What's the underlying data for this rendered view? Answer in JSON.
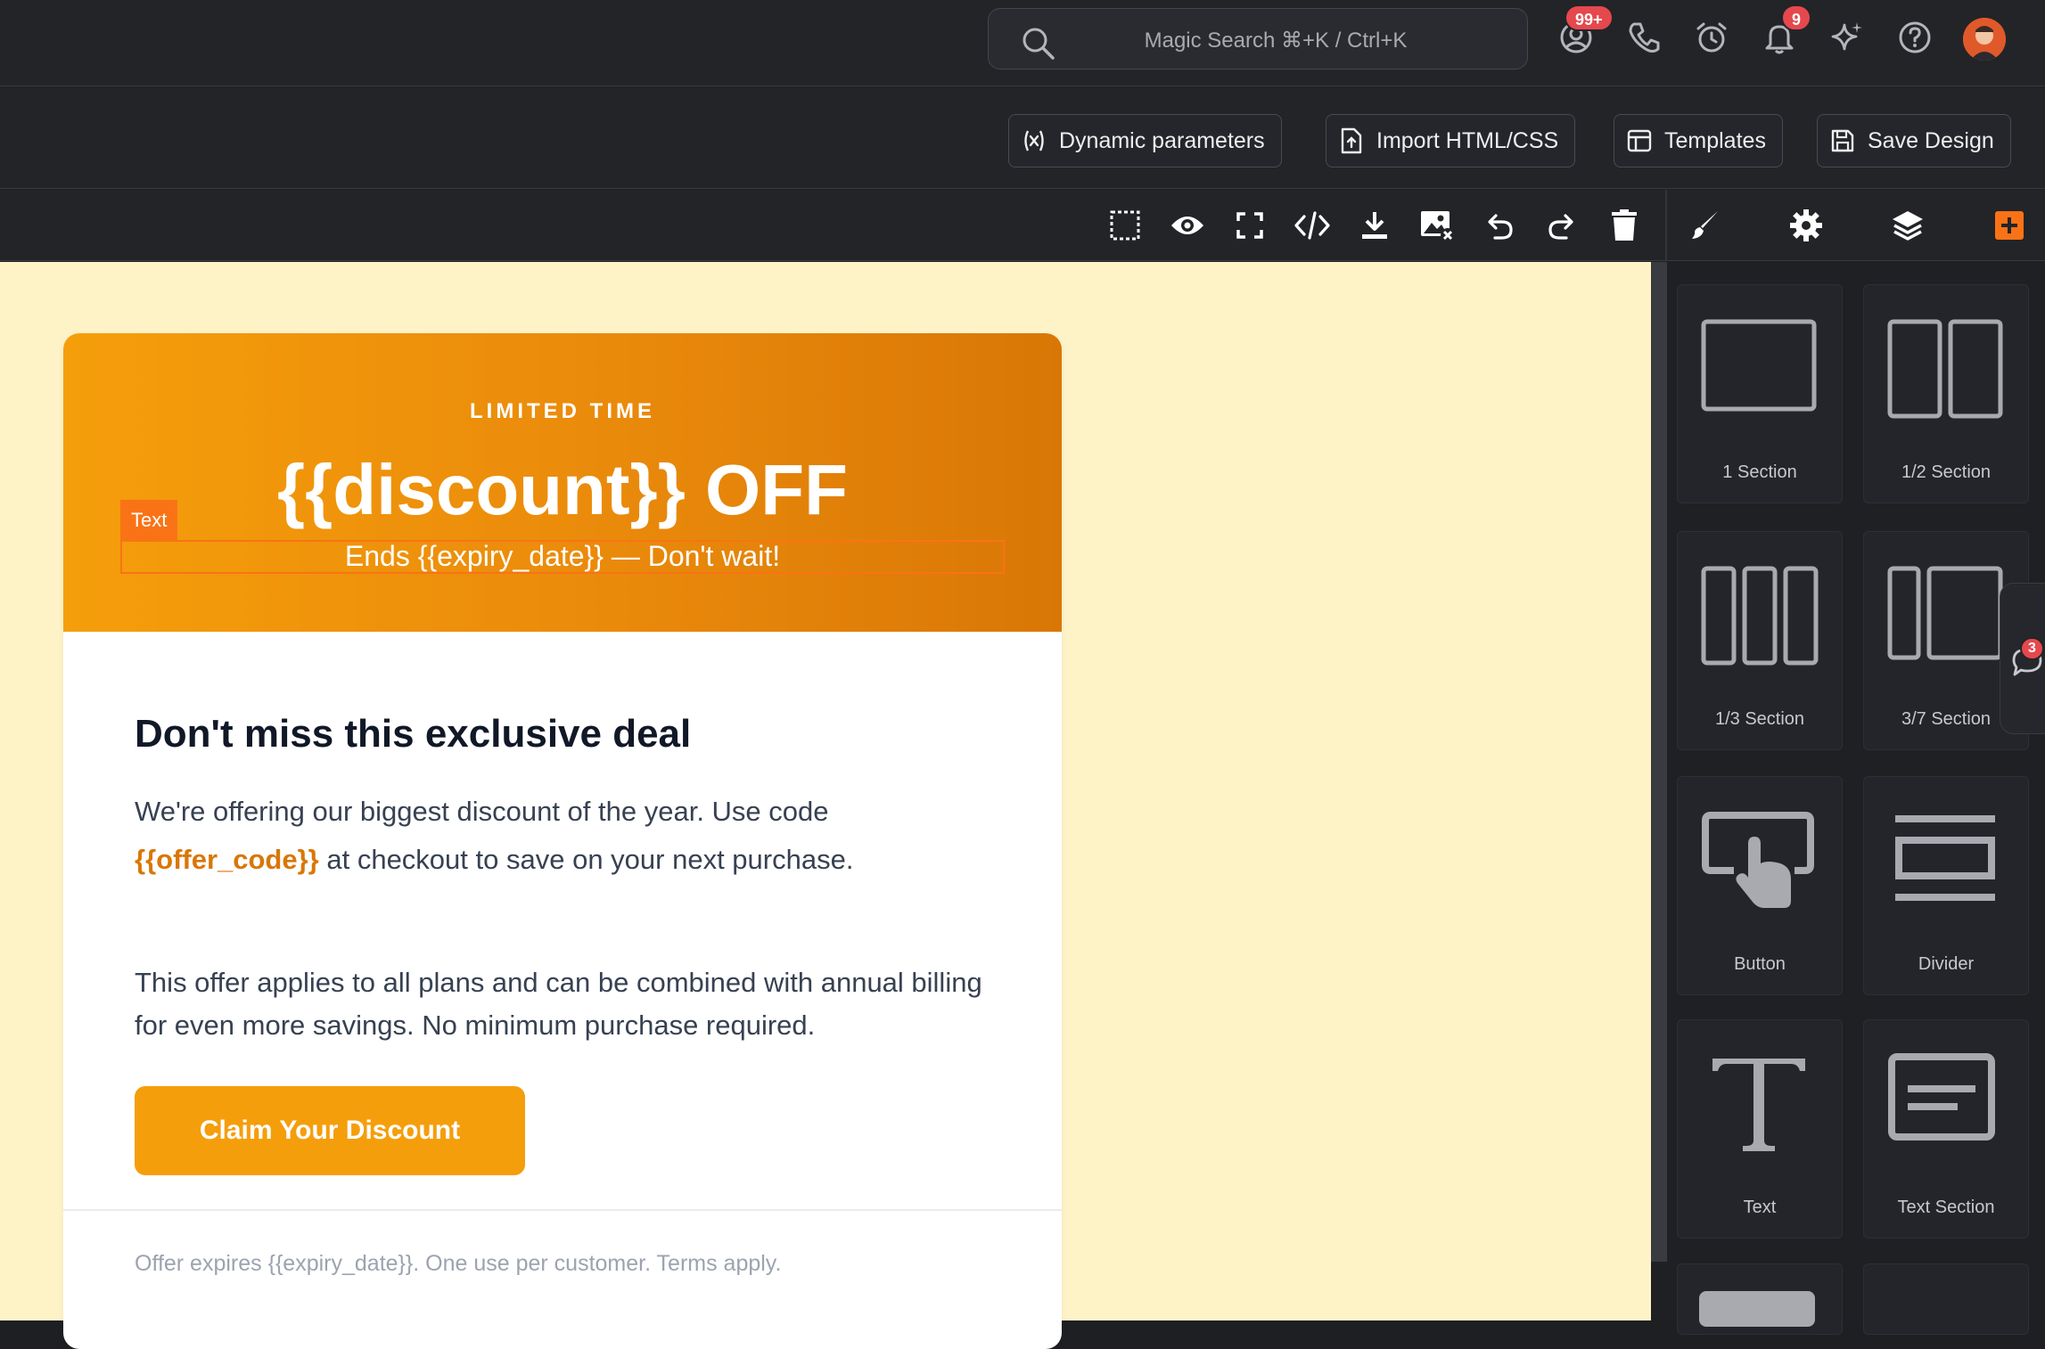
{
  "header": {
    "search_placeholder": "Magic Search ⌘+K / Ctrl+K",
    "badges": {
      "contacts": "99+",
      "notifications": "9"
    }
  },
  "actions": {
    "dynamic_parameters": "Dynamic parameters",
    "import_html": "Import HTML/CSS",
    "templates": "Templates",
    "save_design": "Save Design"
  },
  "email": {
    "kicker": "LIMITED TIME",
    "title": "{{discount}} OFF",
    "subtitle": "Ends {{expiry_date}} — Don't wait!",
    "selection_label": "Text",
    "heading": "Don't miss this exclusive deal",
    "p1_before": "We're offering our biggest discount of the year. Use code",
    "p1_code": "{{offer_code}}",
    "p1_after": " at checkout to save on your next purchase.",
    "p2": "This offer applies to all plans and can be combined with annual billing for even more savings. No minimum purchase required.",
    "cta": "Claim Your Discount",
    "footer": "Offer expires {{expiry_date}}. One use per customer. Terms apply."
  },
  "blocks": [
    {
      "label": "1 Section",
      "icon": "one-section-icon"
    },
    {
      "label": "1/2 Section",
      "icon": "half-section-icon"
    },
    {
      "label": "1/3 Section",
      "icon": "third-section-icon"
    },
    {
      "label": "3/7 Section",
      "icon": "three-seven-section-icon"
    },
    {
      "label": "Button",
      "icon": "button-block-icon"
    },
    {
      "label": "Divider",
      "icon": "divider-block-icon"
    },
    {
      "label": "Text",
      "icon": "text-block-icon"
    },
    {
      "label": "Text Section",
      "icon": "text-section-icon"
    }
  ],
  "chat_badge": "3",
  "colors": {
    "accent": "#f59e0b",
    "accent_dark": "#d97706",
    "canvas_bg": "#fef3c7",
    "dark_bg": "#232428"
  }
}
